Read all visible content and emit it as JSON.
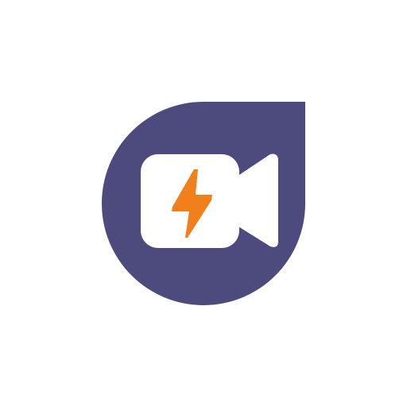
{
  "logo": {
    "icon": "video-camera-lightning-icon",
    "colors": {
      "background": "#ffffff",
      "drop": "#4d4a7e",
      "camera": "#ffffff",
      "bolt": "#f07f1c"
    }
  }
}
